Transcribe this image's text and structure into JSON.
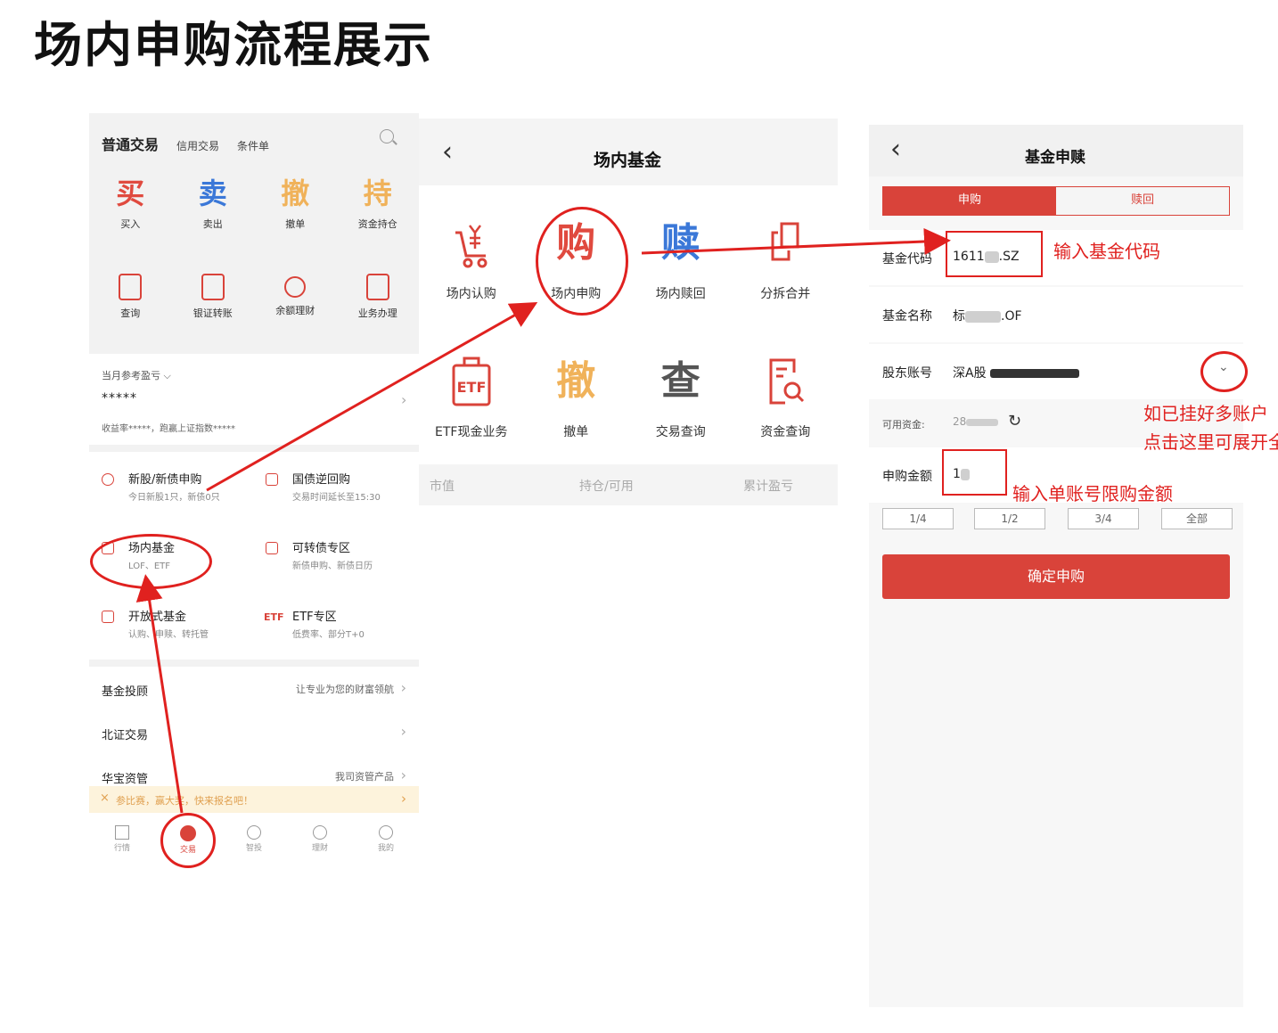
{
  "title": "场内申购流程展示",
  "screen1": {
    "tabs": [
      "普通交易",
      "信用交易",
      "条件单"
    ],
    "actions": [
      {
        "char": "买",
        "label": "买入",
        "color": "#e04a3f"
      },
      {
        "char": "卖",
        "label": "卖出",
        "color": "#3b78d8"
      },
      {
        "char": "撤",
        "label": "撤单",
        "color": "#f0b25a"
      },
      {
        "char": "持",
        "label": "资金持仓",
        "color": "#f0b25a"
      }
    ],
    "tools": [
      {
        "icon": "search-doc-icon",
        "label": "查询"
      },
      {
        "icon": "transfer-icon",
        "label": "银证转账"
      },
      {
        "icon": "money-bag-icon",
        "label": "余额理财"
      },
      {
        "icon": "clipboard-icon",
        "label": "业务办理"
      }
    ],
    "profit_label": "当月参考盈亏",
    "profit_value": "*****",
    "yield_text": "收益率*****，跑赢上证指数*****",
    "menu": [
      {
        "title": "新股/新债申购",
        "sub": "今日新股1只，新债0只"
      },
      {
        "title": "国债逆回购",
        "sub": "交易时间延长至15:30"
      },
      {
        "title": "场内基金",
        "sub": "LOF、ETF"
      },
      {
        "title": "可转债专区",
        "sub": "新债申购、新债日历"
      },
      {
        "title": "开放式基金",
        "sub": "认购、申赎、转托管"
      },
      {
        "title": "ETF专区",
        "sub": "低费率、部分T+0"
      }
    ],
    "etf_badge": "ETF",
    "rows": [
      {
        "title": "基金投顾",
        "right": "让专业为您的财富领航"
      },
      {
        "title": "北证交易",
        "right": ""
      },
      {
        "title": "华宝资管",
        "right": "我司资管产品"
      }
    ],
    "banner": "参比赛，赢大奖，快来报名吧！",
    "tabbar": [
      "行情",
      "交易",
      "智投",
      "理财",
      "我的"
    ]
  },
  "screen2": {
    "title": "场内基金",
    "items": [
      {
        "label": "场内认购"
      },
      {
        "label": "场内申购",
        "char": "购",
        "color": "#e04a3f"
      },
      {
        "label": "场内赎回",
        "char": "赎",
        "color": "#3b78d8"
      },
      {
        "label": "分拆合并"
      },
      {
        "label": "ETF现金业务",
        "badge": "ETF"
      },
      {
        "label": "撤单",
        "char": "撤",
        "color": "#f0b25a"
      },
      {
        "label": "交易查询",
        "char": "查",
        "color": "#555555"
      },
      {
        "label": "资金查询"
      }
    ],
    "columns": [
      "市值",
      "持仓/可用",
      "累计盈亏"
    ]
  },
  "screen3": {
    "title": "基金申赎",
    "seg": [
      "申购",
      "赎回"
    ],
    "fields": {
      "code_label": "基金代码",
      "code_prefix": "1611",
      "code_suffix": ".SZ",
      "name_label": "基金名称",
      "name_prefix": "标",
      "name_suffix": ".OF",
      "holder_label": "股东账号",
      "holder_prefix": "深A股",
      "cash_label": "可用资金:",
      "cash_prefix": "28",
      "amount_label": "申购金额",
      "amount_prefix": "1"
    },
    "quick": [
      "1/4",
      "1/2",
      "3/4",
      "全部"
    ],
    "submit": "确定申购"
  },
  "annotations": {
    "code": "输入基金代码",
    "multi_line1": "如已挂好多账户",
    "multi_line2": "点击这里可展开全",
    "amount": "输入单账号限购金额"
  },
  "colors": {
    "accent": "#d9433a",
    "annotation": "#e0211f"
  }
}
